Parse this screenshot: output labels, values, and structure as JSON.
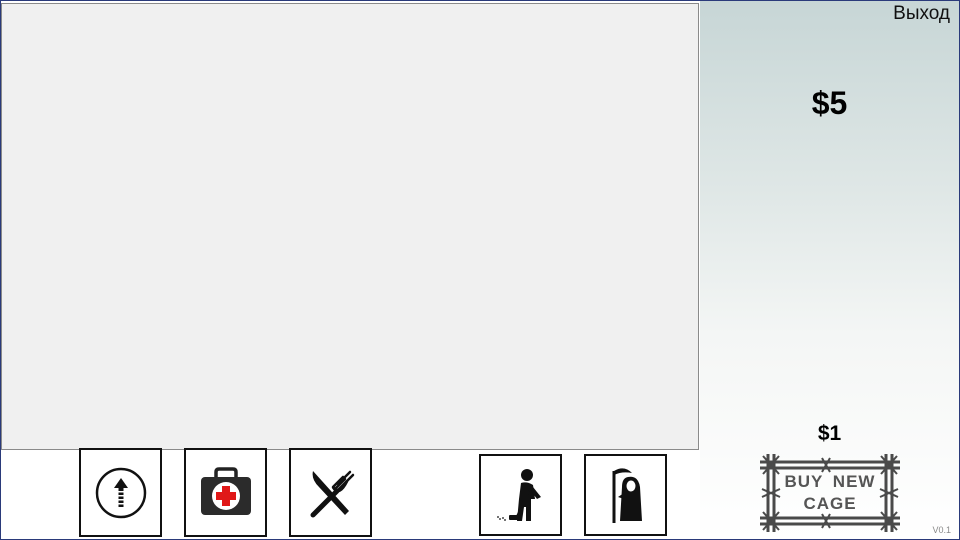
{
  "header": {
    "exit_label": "Выход"
  },
  "stats": {
    "money": "$5"
  },
  "shop": {
    "cage_price": "$1",
    "buy_cage_line1": "BUY NEW",
    "buy_cage_line2": "CAGE"
  },
  "footer": {
    "version": "V0.1"
  },
  "toolbar": {
    "buttons": [
      {
        "id": "upgrade",
        "icon": "arrow-up-circle-icon"
      },
      {
        "id": "heal",
        "icon": "first-aid-kit-icon"
      },
      {
        "id": "feed",
        "icon": "fork-knife-icon"
      },
      {
        "id": "clean",
        "icon": "sweeping-janitor-icon"
      },
      {
        "id": "reaper",
        "icon": "grim-reaper-icon"
      }
    ]
  },
  "colors": {
    "playfield": "#f0f0f0",
    "panel_top": "#c7d6d6",
    "kit_red": "#e01818",
    "frame": "#2a3a7a"
  }
}
